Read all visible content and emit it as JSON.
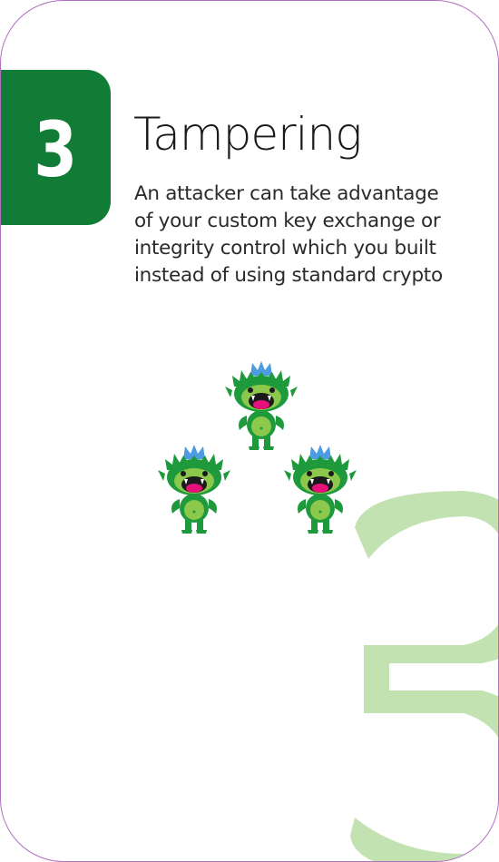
{
  "card": {
    "number": "3",
    "title": "Tampering",
    "description_lines": [
      "An attacker can take advantage",
      "of your custom key exchange or",
      "integrity control which you built",
      "instead of using standard crypto"
    ],
    "watermark_number": "3"
  },
  "colors": {
    "accent": "#107c35",
    "watermark": "#c3e2b2",
    "border": "#b070c0",
    "monster_body": "#1e9a3c",
    "monster_belly": "#8cc84b",
    "crown": "#4d9be0",
    "mouth": "#e5107a"
  },
  "icons": [
    "monster-icon",
    "monster-icon",
    "monster-icon"
  ]
}
